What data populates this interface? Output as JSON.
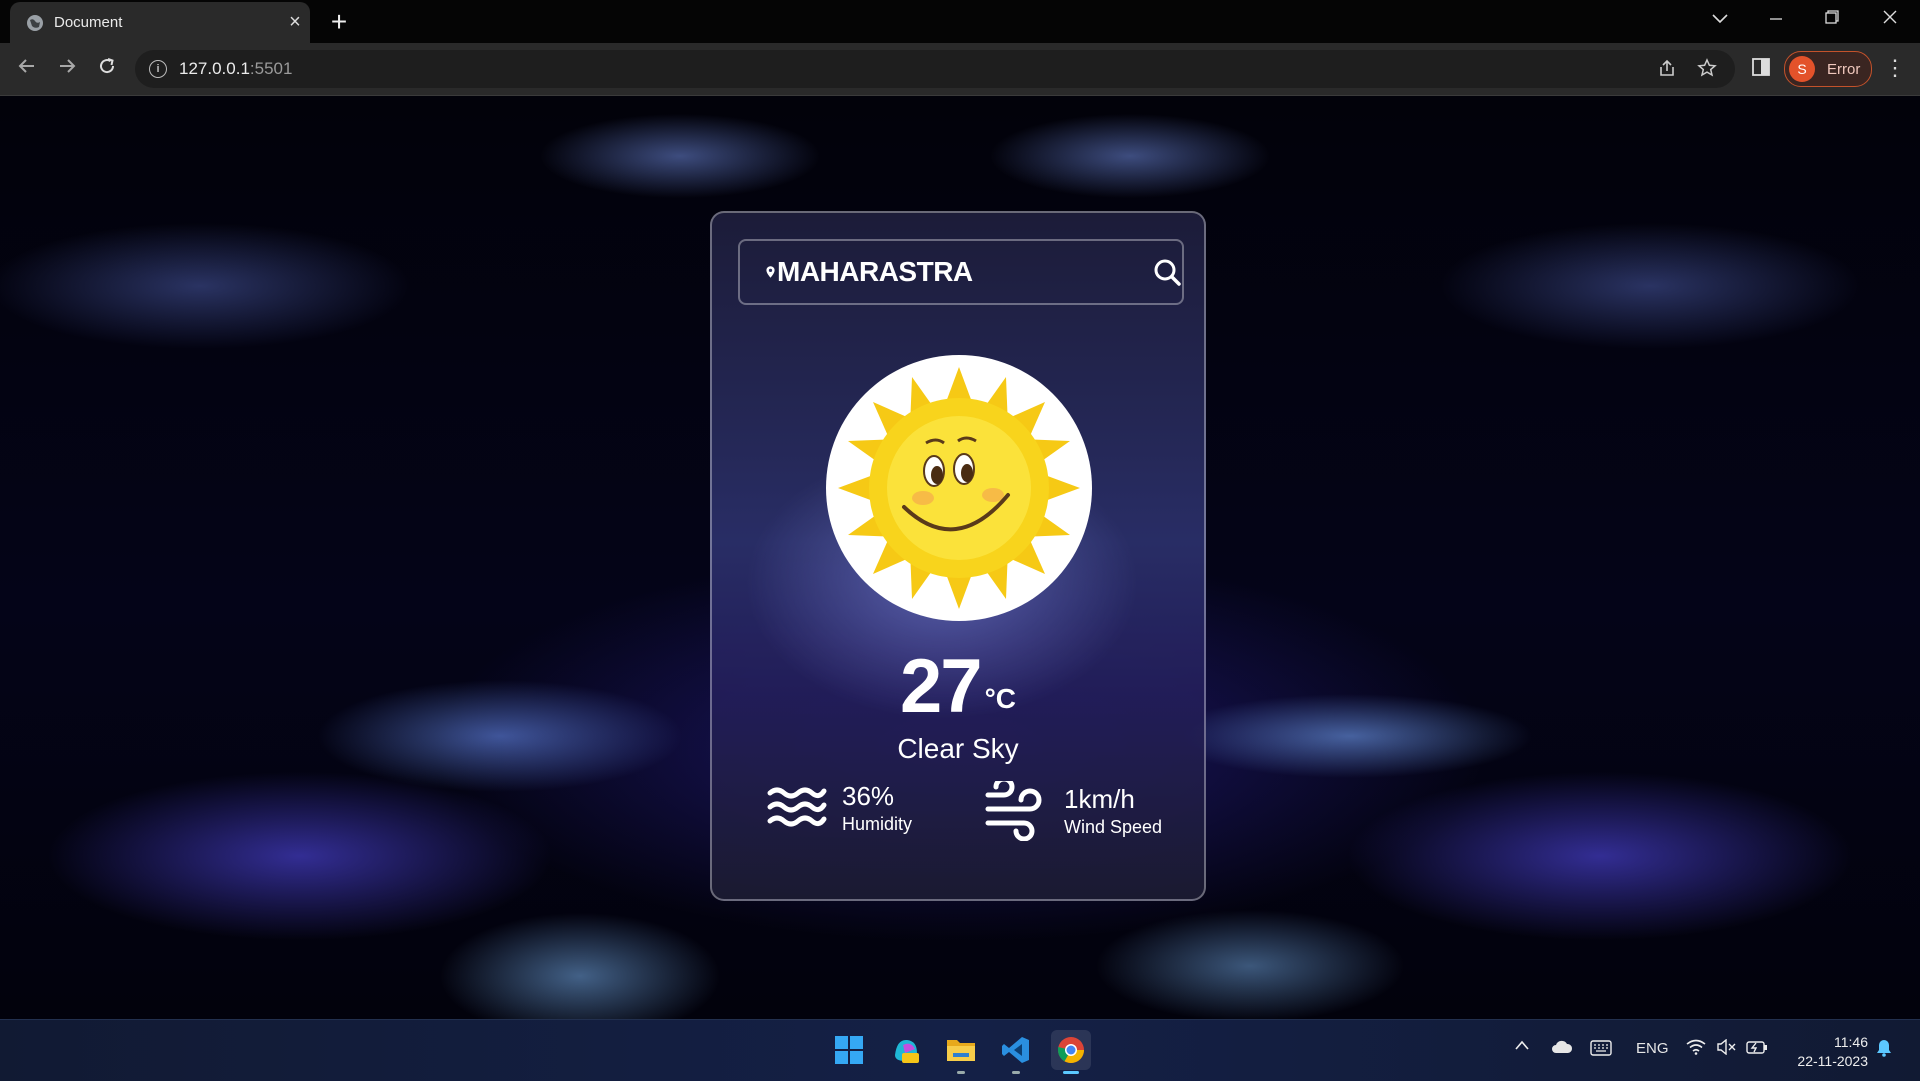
{
  "browser": {
    "tab_title": "Document",
    "url_host": "127.0.0.1",
    "url_port": ":5501",
    "profile_initial": "S",
    "profile_status": "Error"
  },
  "weather": {
    "search_value": "MAHARASTRA",
    "temperature": "27",
    "unit": "°C",
    "description": "Clear Sky",
    "humidity_value": "36%",
    "humidity_label": "Humidity",
    "wind_value": "1km/h",
    "wind_label": "Wind Speed"
  },
  "taskbar": {
    "language": "ENG",
    "time": "11:46",
    "date": "22-11-2023"
  },
  "colors": {
    "sun_yellow": "#f6d31a",
    "profile_accent": "#e3522a",
    "card_border": "rgba(255,255,255,0.35)"
  }
}
